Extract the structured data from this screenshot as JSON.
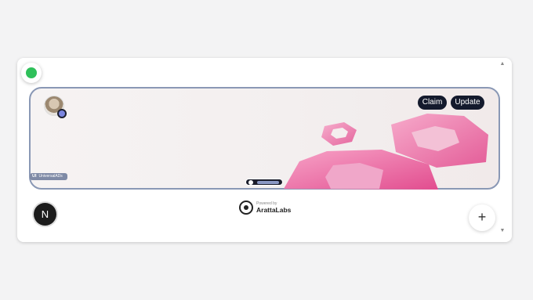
{
  "widget": {
    "status_color": "#2fc05a",
    "icons": {
      "status": "status-dot-icon",
      "avatar": "user-avatar",
      "scroll_up": "arrow-up-icon",
      "scroll_down": "arrow-down-icon"
    }
  },
  "banner": {
    "claim_label": "Claim",
    "update_label": "Update",
    "brand_mark": "UI",
    "brand_name": "UniversalADs",
    "media_icon": "play-icon"
  },
  "footer": {
    "next_logo": "N",
    "powered_small": "Powered by",
    "powered_name": "ArattaLabs",
    "plus_label": "+"
  }
}
